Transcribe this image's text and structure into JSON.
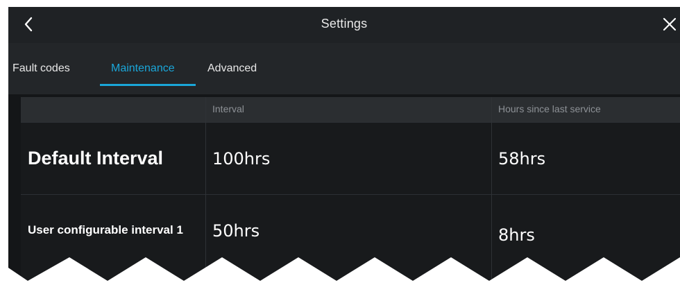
{
  "header": {
    "title": "Settings",
    "back_icon": "chevron-left-icon",
    "close_icon": "close-icon"
  },
  "tabs": [
    {
      "label": "Fault codes",
      "active": false
    },
    {
      "label": "Maintenance",
      "active": true
    },
    {
      "label": "Advanced",
      "active": false
    }
  ],
  "table": {
    "columns": [
      "",
      "Interval",
      "Hours since last service"
    ],
    "rows": [
      {
        "label": "Default Interval",
        "interval": "100hrs",
        "hours_since_service": "58hrs"
      },
      {
        "label": "User configurable interval 1",
        "interval": "50hrs",
        "hours_since_service": "8hrs"
      }
    ]
  },
  "colors": {
    "accent": "#1aa6d9",
    "background": "#141618",
    "header_bar": "#1f2225"
  }
}
